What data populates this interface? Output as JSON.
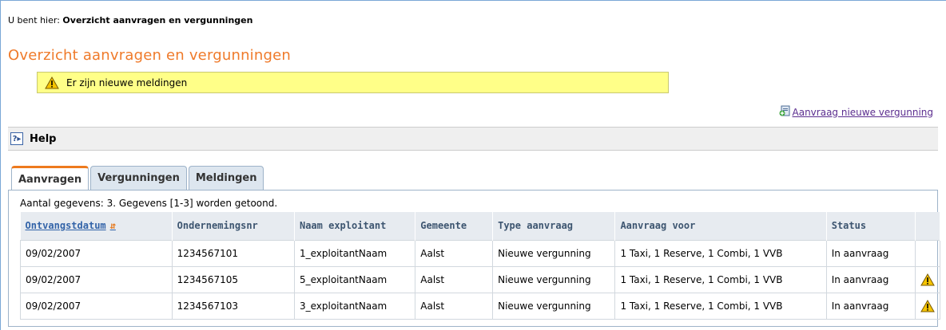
{
  "breadcrumb": {
    "prefix": "U bent hier:",
    "current": "Overzicht aanvragen en vergunningen"
  },
  "page": {
    "title": "Overzicht aanvragen en vergunningen"
  },
  "notice": {
    "text": "Er zijn nieuwe meldingen",
    "icon": "warning-icon",
    "bg_color": "#ffff88"
  },
  "actions": {
    "new_request_label": "Aanvraag nieuwe vergunning",
    "icon": "new-document-icon"
  },
  "help": {
    "label": "Help",
    "icon": "help-icon"
  },
  "tabs": [
    {
      "label": "Aanvragen",
      "active": true
    },
    {
      "label": "Vergunningen",
      "active": false
    },
    {
      "label": "Meldingen",
      "active": false
    }
  ],
  "accent_color": "#ef7a2a",
  "table": {
    "summary": "Aantal gegevens: 3. Gegevens [1-3] worden getoond.",
    "headers": [
      "Ontvangstdatum",
      "Ondernemingsnr",
      "Naam exploitant",
      "Gemeente",
      "Type aanvraag",
      "Aanvraag voor",
      "Status",
      ""
    ],
    "sort_icon": "sort-icon",
    "rows": [
      {
        "date": "09/02/2007",
        "nr": "1234567101",
        "name": "1_exploitantNaam",
        "gemeente": "Aalst",
        "type": "Nieuwe vergunning",
        "voor": "1 Taxi, 1 Reserve, 1 Combi, 1 VVB",
        "status": "In aanvraag",
        "warning": false
      },
      {
        "date": "09/02/2007",
        "nr": "1234567105",
        "name": "5_exploitantNaam",
        "gemeente": "Aalst",
        "type": "Nieuwe vergunning",
        "voor": "1 Taxi, 1 Reserve, 1 Combi, 1 VVB",
        "status": "In aanvraag",
        "warning": true
      },
      {
        "date": "09/02/2007",
        "nr": "1234567103",
        "name": "3_exploitantNaam",
        "gemeente": "Aalst",
        "type": "Nieuwe vergunning",
        "voor": "1 Taxi, 1 Reserve, 1 Combi, 1 VVB",
        "status": "In aanvraag",
        "warning": true
      }
    ]
  }
}
